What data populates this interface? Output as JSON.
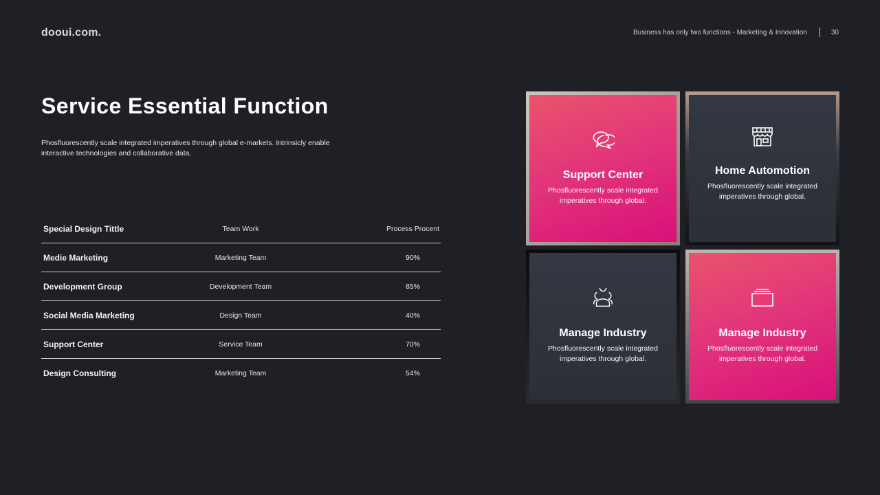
{
  "header": {
    "logo": "dooui.com.",
    "tagline": "Business has only two functions - Marketing & Innovation",
    "page_number": "30"
  },
  "main": {
    "title": "Service Essential Function",
    "intro": "Phosfluorescently scale integrated imperatives through global e-markets. Intrinsicly enable interactive technologies and collaborative data."
  },
  "table": {
    "headers": [
      "Special Design Tittle",
      "Team Work",
      "Process Procent"
    ],
    "rows": [
      [
        "Medie Marketing",
        "Marketing Team",
        "90%"
      ],
      [
        "Development Group",
        "Development Team",
        "85%"
      ],
      [
        "Social Media Marketing",
        "Design Team",
        "40%"
      ],
      [
        "Support Center",
        "Service Team",
        "70%"
      ],
      [
        "Design Consulting",
        "Marketing Team",
        "54%"
      ]
    ]
  },
  "tiles": [
    {
      "title": "Support Center",
      "text": "Phosfluorescently scale integrated imperatives through global.",
      "icon": "chat-bubbles-icon",
      "style": "pink"
    },
    {
      "title": "Home Automotion",
      "text": "Phosfluorescently scale integrated imperatives through global.",
      "icon": "storefront-icon",
      "style": "dark"
    },
    {
      "title": "Manage Industry",
      "text": "Phosfluorescently scale integrated imperatives through global.",
      "icon": "users-icon",
      "style": "dark"
    },
    {
      "title": "Manage Industry",
      "text": "Phosfluorescently scale integrated imperatives through global.",
      "icon": "stacked-cards-icon",
      "style": "pink"
    }
  ],
  "colors": {
    "background": "#1f2025",
    "accent_pink": "#e2367a",
    "panel_dark": "#2f333c"
  }
}
